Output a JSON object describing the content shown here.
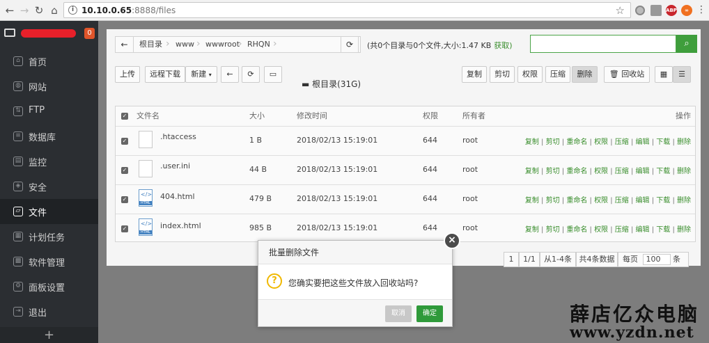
{
  "browser": {
    "url_host": "10.10.0.65",
    "url_rest": ":8888/files",
    "ext_abp": "ABP"
  },
  "sidebar": {
    "badge": "0",
    "items": [
      {
        "label": "首页",
        "icon": "home-icon"
      },
      {
        "label": "网站",
        "icon": "globe-icon"
      },
      {
        "label": "FTP",
        "icon": "ftp-icon"
      },
      {
        "label": "数据库",
        "icon": "database-icon"
      },
      {
        "label": "监控",
        "icon": "monitor-icon"
      },
      {
        "label": "安全",
        "icon": "shield-icon"
      },
      {
        "label": "文件",
        "icon": "folder-icon"
      },
      {
        "label": "计划任务",
        "icon": "calendar-icon"
      },
      {
        "label": "软件管理",
        "icon": "grid-icon"
      },
      {
        "label": "面板设置",
        "icon": "gear-icon"
      },
      {
        "label": "退出",
        "icon": "logout-icon"
      }
    ],
    "plus": "+"
  },
  "breadcrumb": [
    "根目录",
    "www",
    "wwwroot",
    "RHQN"
  ],
  "dirinfo": {
    "text": "(共0个目录与0个文件,大小:1.47 KB",
    "get": "获取)"
  },
  "toolbar": {
    "upload": "上传",
    "remote_download": "远程下载",
    "new": "新建",
    "disk": "根目录(31G)",
    "copy": "复制",
    "cut": "剪切",
    "perm": "权限",
    "compress": "压缩",
    "delete": "删除",
    "recycle": "回收站"
  },
  "table": {
    "headers": {
      "name": "文件名",
      "size": "大小",
      "mtime": "修改时间",
      "perm": "权限",
      "owner": "所有者",
      "ops": "操作"
    },
    "rows": [
      {
        "name": ".htaccess",
        "size": "1 B",
        "mtime": "2018/02/13 15:19:01",
        "perm": "644",
        "owner": "root",
        "type": "file"
      },
      {
        "name": ".user.ini",
        "size": "44 B",
        "mtime": "2018/02/13 15:19:01",
        "perm": "644",
        "owner": "root",
        "type": "file"
      },
      {
        "name": "404.html",
        "size": "479 B",
        "mtime": "2018/02/13 15:19:01",
        "perm": "644",
        "owner": "root",
        "type": "html"
      },
      {
        "name": "index.html",
        "size": "985 B",
        "mtime": "2018/02/13 15:19:01",
        "perm": "644",
        "owner": "root",
        "type": "html"
      }
    ],
    "ops": [
      "复制",
      "剪切",
      "重命名",
      "权限",
      "压缩",
      "编辑",
      "下载",
      "删除"
    ]
  },
  "pager": {
    "page": "1",
    "pages": "1/1",
    "range": "从1-4条",
    "total": "共4条数据",
    "per_label": "每页",
    "per_value": "100",
    "unit": "条"
  },
  "dialog": {
    "title": "批量删除文件",
    "message": "您确实要把这些文件放入回收站吗?",
    "cancel": "取消",
    "ok": "确定"
  },
  "watermark": {
    "line1": "薛店亿众电脑",
    "line2": "www.yzdn.net"
  },
  "colors": {
    "accent": "#3f9e3c",
    "sidebar": "#2b2e32",
    "warn": "#f0b800"
  }
}
